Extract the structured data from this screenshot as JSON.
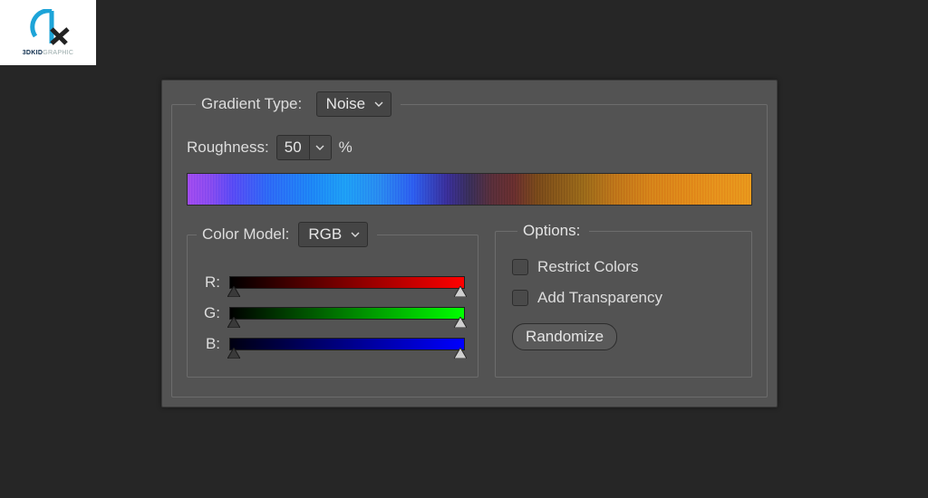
{
  "logo": {
    "brand": "3DKID",
    "sub": "GRAPHIC"
  },
  "panel": {
    "gradientType": {
      "label": "Gradient Type:",
      "value": "Noise"
    },
    "roughness": {
      "label": "Roughness:",
      "value": "50",
      "unit": "%"
    },
    "colorModel": {
      "label": "Color Model:",
      "value": "RGB",
      "channels": {
        "r": "R:",
        "g": "G:",
        "b": "B:"
      }
    },
    "options": {
      "legend": "Options:",
      "restrict": "Restrict Colors",
      "addTransparency": "Add Transparency",
      "randomize": "Randomize"
    }
  }
}
